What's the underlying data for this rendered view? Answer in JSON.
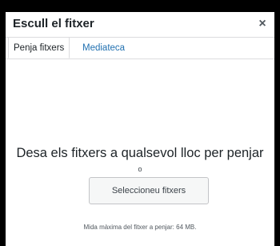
{
  "modal": {
    "title": "Escull el fitxer",
    "close_glyph": "×",
    "close_icon": "close-icon"
  },
  "tabs": [
    {
      "label": "Penja fitxers",
      "active": true
    },
    {
      "label": "Mediateca",
      "active": false
    }
  ],
  "uploader": {
    "instructions": "Desa els fitxers a qualsevol lloc per penjar",
    "or_text": "o",
    "select_button_label": "Seleccioneu fitxers",
    "max_size_text": "Mida màxima del fitxer a penjar: 64 MB."
  },
  "colors": {
    "backdrop": "#000000",
    "link": "#2271b1",
    "text": "#1d2327",
    "border": "#dcdcde"
  }
}
